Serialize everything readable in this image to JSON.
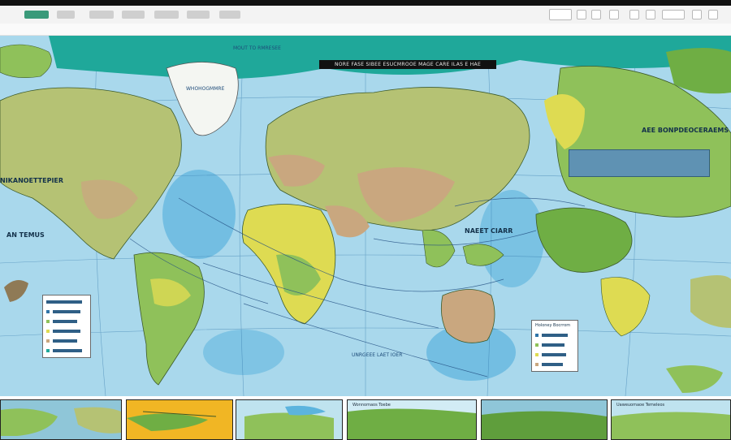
{
  "window": {
    "tabs": [
      {
        "label": ""
      },
      {
        "label": ""
      },
      {
        "label": ""
      },
      {
        "label": ""
      },
      {
        "label": ""
      },
      {
        "label": ""
      },
      {
        "label": ""
      }
    ],
    "search": {
      "placeholder": ""
    }
  },
  "map": {
    "title": "NORE FASE SIBEE ESUCMROOE MAGE CARE ILAS E HAE",
    "labels": {
      "arctic": "MOUT TO RMRESEE",
      "greenland": "WHOHOGMMRE",
      "north_america": "NIKANOETTEPIER",
      "atlantic": "AN TEMUS",
      "indian_ocean": "NAEET CIARR",
      "asia_pacific": "AEE BONPDEOCERAEMS",
      "south_ocean": "UNRGEEE LAET IOER",
      "legend_right": "Holoney Bocrrom"
    },
    "colors": {
      "ocean": "#a9d8ec",
      "deep_ocean": "#5cb4de",
      "land_green": "#8fc15a",
      "land_olive": "#b5c274",
      "land_tan": "#c9a77f",
      "land_yellow": "#dedb52",
      "arctic_teal": "#1fa89a",
      "ice": "#f4f6f2"
    }
  },
  "thumbnails": {
    "captions": [
      "",
      "",
      "",
      "Wonnomaos Toebe",
      "",
      "Uaweuomaoe Temeleos"
    ]
  }
}
